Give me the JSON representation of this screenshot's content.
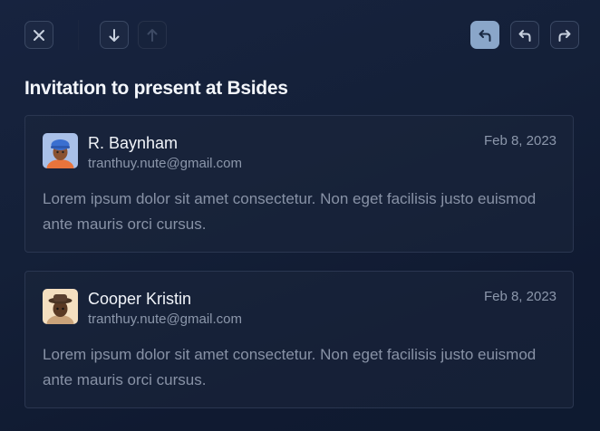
{
  "toolbar": {
    "close_icon": "close-icon",
    "next_icon": "arrow-down-icon",
    "prev_icon": "arrow-up-icon",
    "reply_icon": "reply-icon",
    "reply_all_icon": "reply-all-icon",
    "forward_icon": "forward-icon"
  },
  "thread": {
    "subject": "Invitation to present at Bsides",
    "messages": [
      {
        "sender": "R. Baynham",
        "email": "tranthuy.nute@gmail.com",
        "date": "Feb 8, 2023",
        "body": "Lorem ipsum dolor sit amet consectetur. Non eget facilisis justo euismod ante mauris orci cursus."
      },
      {
        "sender": "Cooper Kristin",
        "email": "tranthuy.nute@gmail.com",
        "date": "Feb 8, 2023",
        "body": "Lorem ipsum dolor sit amet consectetur. Non eget facilisis justo euismod ante mauris orci cursus."
      }
    ]
  },
  "colors": {
    "background": "#142038",
    "active_button": "#8aa6c9",
    "card_border": "#2a3650"
  }
}
